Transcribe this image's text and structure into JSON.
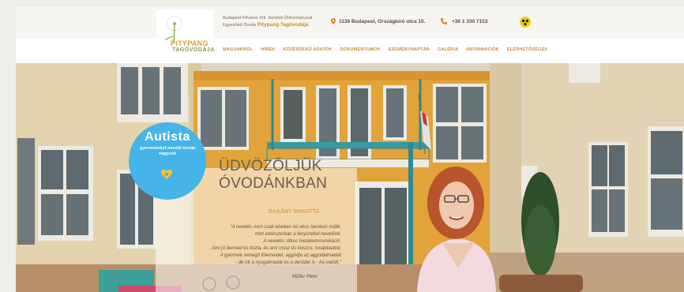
{
  "header": {
    "logo_line1": "PITYPANG",
    "logo_line2": "TAGÓVODÁJA",
    "org_line1": "Budapest Főváros XIII. Kerületi Önkormányzat",
    "org_line2_prefix": "Egyesített Óvoda",
    "org_line2_highlight": "Pitypang Tagóvodája",
    "address": "1139 Budapest, Országbíró utca 10.",
    "phone": "+36 1 330 7153"
  },
  "nav": {
    "items": [
      "MAGUNKRÓL",
      "HÍREK",
      "KÖZÉRDEKŰ ADATOK",
      "DOKUMENTUMOK",
      "ESEMÉNYNAPTÁR",
      "GALÉRIA",
      "INFORMÁCIÓK",
      "ELÉRHETŐSÉGEK"
    ]
  },
  "badge": {
    "title": "Autista",
    "subtitle": "gyermekeket nevelő óvoda vagyunk"
  },
  "hero": {
    "welcome_line1": "ÜDVÖZÖLJÜK",
    "welcome_line2": "ÓVODÁNKBAN",
    "speaker": "BAKÁNY BRIGITTA",
    "quote_lines": [
      "\"A nevelés nem csak elveken és okos tanokon múlik,",
      "mint ezekszerban a lényünkkel nevelünk.",
      "A nevelés: titkos metakommunikáció.",
      "Ami jó benned és tiszta, és ami rossz és koszos, továbbadod.",
      "A gyermek remegő fölemeidet, aggódja az aggodalmaidat",
      "- de ott a nyugalmadat és a derűdet is - ha valódi.\""
    ],
    "quote_author": "Müller Péter"
  },
  "colors": {
    "accent": "#c98a2e",
    "badge": "#45b4e8",
    "accessibility": "#f2d000"
  }
}
